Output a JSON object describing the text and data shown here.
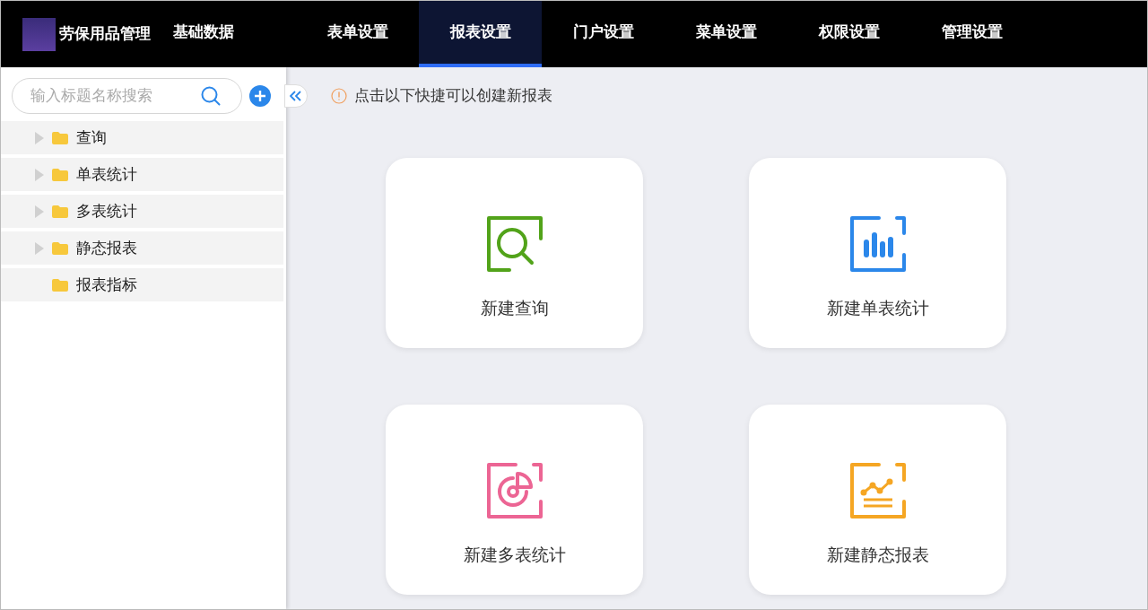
{
  "app": {
    "title": "劳保用品管理"
  },
  "nav": [
    {
      "label": "基础数据",
      "selected": false
    },
    {
      "label": "表单设置",
      "selected": false
    },
    {
      "label": "报表设置",
      "selected": true
    },
    {
      "label": "门户设置",
      "selected": false
    },
    {
      "label": "菜单设置",
      "selected": false
    },
    {
      "label": "权限设置",
      "selected": false
    },
    {
      "label": "管理设置",
      "selected": false
    }
  ],
  "sidebar": {
    "search": {
      "placeholder": "输入标题名称搜索"
    },
    "tree": [
      {
        "label": "查询",
        "kind": "folder",
        "expanded": false
      },
      {
        "label": "单表统计",
        "kind": "folder",
        "expanded": false
      },
      {
        "label": "多表统计",
        "kind": "folder",
        "expanded": false
      },
      {
        "label": "静态报表",
        "kind": "folder",
        "expanded": false
      },
      {
        "label": "报表指标",
        "kind": "leaf"
      }
    ]
  },
  "hint": "点击以下快捷可以创建新报表",
  "cards": [
    {
      "label": "新建查询",
      "kind": "search",
      "color": "#52a31a"
    },
    {
      "label": "新建单表统计",
      "kind": "bar",
      "color": "#2b87ea"
    },
    {
      "label": "新建多表统计",
      "kind": "pie",
      "color": "#ec6594"
    },
    {
      "label": "新建静态报表",
      "kind": "line",
      "color": "#f5a623"
    }
  ]
}
